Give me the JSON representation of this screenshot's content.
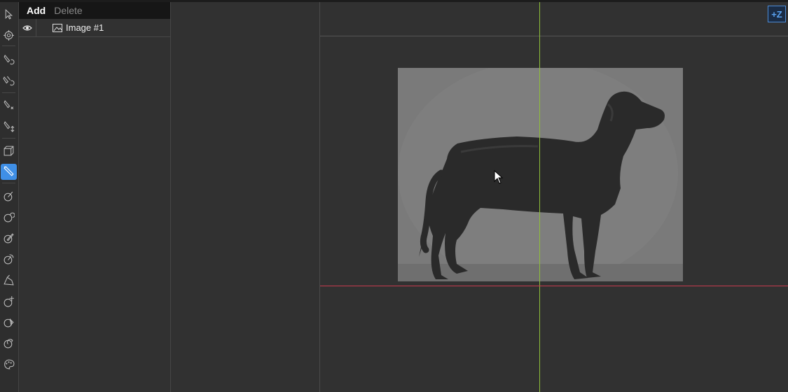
{
  "layers_panel": {
    "add_label": "Add",
    "delete_label": "Delete",
    "layers": [
      {
        "name": "Image #1",
        "visible": true
      }
    ]
  },
  "viewport": {
    "zoom_button_label": "+Z"
  },
  "toolbar": {
    "tools": [
      "select-arrow-icon",
      "crosshair-icon",
      "pin-rotate-icon",
      "pins-rotate-icon",
      "pin-scale-icon",
      "pin-move-icon",
      "box-3d-icon",
      "brush-tool-icon",
      "bone-add-icon",
      "bone-circle-icon",
      "bone-edit-icon",
      "bone-rotate-icon",
      "bone-bend-icon",
      "bone-move-icon",
      "bone-select-icon",
      "bone-weight-icon",
      "palette-icon"
    ],
    "active_tool": "brush-tool-icon"
  },
  "colors": {
    "accent": "#3f8fe6",
    "guide_vertical": "#8fbf3a",
    "guide_horizontal": "#c83a4e"
  }
}
